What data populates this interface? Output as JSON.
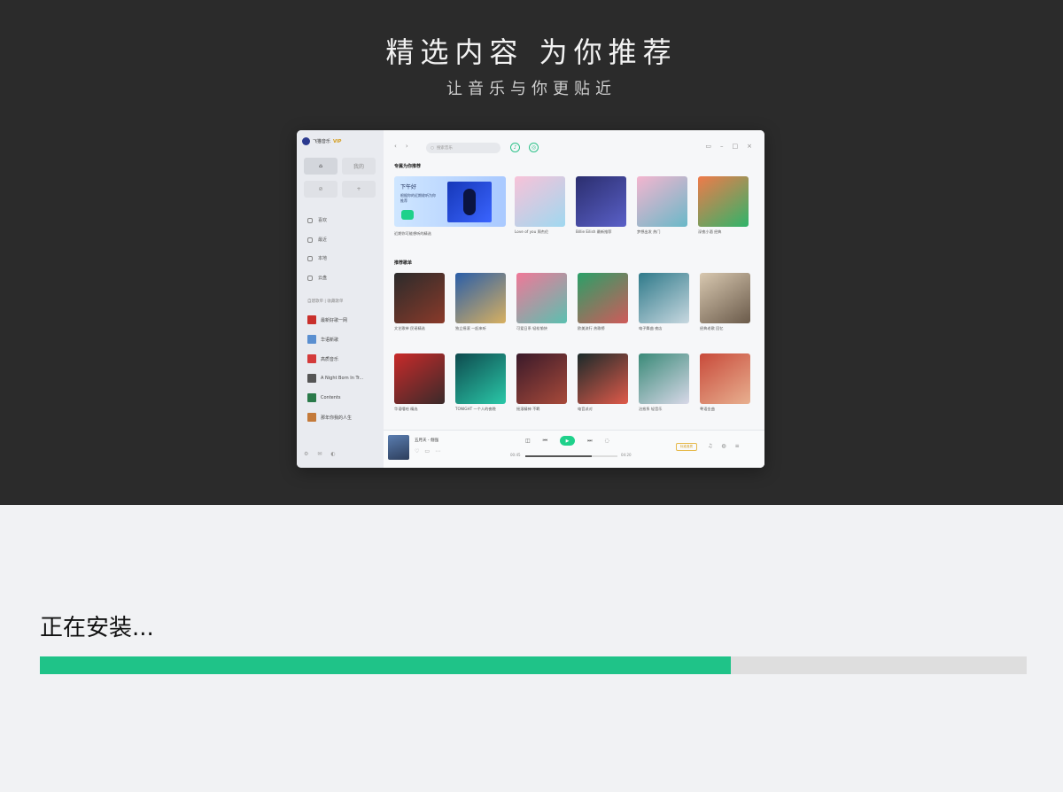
{
  "hero": {
    "title": "精选内容 为你推荐",
    "subtitle": "让音乐与你更贴近"
  },
  "preview": {
    "brand": "飞猫音乐",
    "brand_badge": "VIP",
    "side_buttons": [
      "⌂",
      "我的",
      "⊘",
      "+"
    ],
    "nav_items": [
      "喜欢",
      "最近",
      "本地",
      "云盘"
    ],
    "playlist_section": "自建歌单 | 收藏歌单",
    "playlists": [
      {
        "label": "最新好歌一网",
        "color": "#c9302c"
      },
      {
        "label": "华语新歌",
        "color": "#5a8fd0"
      },
      {
        "label": "高质音乐",
        "color": "#d43b3b"
      },
      {
        "label": "A Night Born In Tr...",
        "color": "#555555"
      },
      {
        "label": "Contents",
        "color": "#2a7a4a"
      },
      {
        "label": "那年你我的人生",
        "color": "#c47a3a"
      }
    ],
    "search_placeholder": "搜索音乐",
    "section1": "专属为你推荐",
    "section2": "推荐歌单",
    "feature": {
      "title": "下午好",
      "subtitle": "根据你的近期收听为你推荐",
      "caption": "近期你可能想听的精选"
    },
    "row1": [
      {
        "caption": "Love of you 周杰伦",
        "colors": [
          "#f8c2d8",
          "#9fd8f0"
        ]
      },
      {
        "caption": "Billie Eilish 最新推荐",
        "colors": [
          "#2b2e6e",
          "#5a60c8"
        ]
      },
      {
        "caption": "梦想出发 热门",
        "colors": [
          "#f4b5cf",
          "#69b8c8"
        ]
      },
      {
        "caption": "深夜小酒 经典",
        "colors": [
          "#f07a4a",
          "#2fb46a"
        ]
      }
    ],
    "row2": [
      {
        "caption": "文艺歌单 民谣精选",
        "colors": [
          "#2b2b2b",
          "#8a3a2a"
        ]
      },
      {
        "caption": "独立摇滚 一起来听",
        "colors": [
          "#2a5ea8",
          "#d8b060"
        ]
      },
      {
        "caption": "可爱日系 轻松愉快",
        "colors": [
          "#f07898",
          "#5ac0b0"
        ]
      },
      {
        "caption": "欧美流行 热歌榜",
        "colors": [
          "#2aa068",
          "#d05a5a"
        ]
      },
      {
        "caption": "电子舞曲 夜店",
        "colors": [
          "#2f7a8a",
          "#c8d8e0"
        ]
      },
      {
        "caption": "经典老歌 回忆",
        "colors": [
          "#d8c8b0",
          "#6a5a4a"
        ]
      }
    ],
    "row3": [
      {
        "caption": "华语嘻哈 精选",
        "colors": [
          "#c82a2a",
          "#3a2a2a"
        ]
      },
      {
        "caption": "TONIGHT 一个人的夜晚",
        "colors": [
          "#0e4a4e",
          "#2ac8a8"
        ]
      },
      {
        "caption": "摇滚精神 不羁",
        "colors": [
          "#3a1a2a",
          "#a84a3a"
        ]
      },
      {
        "caption": "电音派对",
        "colors": [
          "#1a2a2a",
          "#e05a4a"
        ]
      },
      {
        "caption": "治愈系 轻音乐",
        "colors": [
          "#3a8a78",
          "#d8d8e8"
        ]
      },
      {
        "caption": "粤语金曲",
        "colors": [
          "#c84a3a",
          "#e8b090"
        ]
      }
    ],
    "player": {
      "song": "五月天 - 倔强",
      "time_left": "00:45",
      "time_right": "04:20",
      "progress": 0.72,
      "quality": "标准音质"
    }
  },
  "install": {
    "status": "正在安装...",
    "progress": 0.7,
    "progress_color": "#1fc388"
  }
}
